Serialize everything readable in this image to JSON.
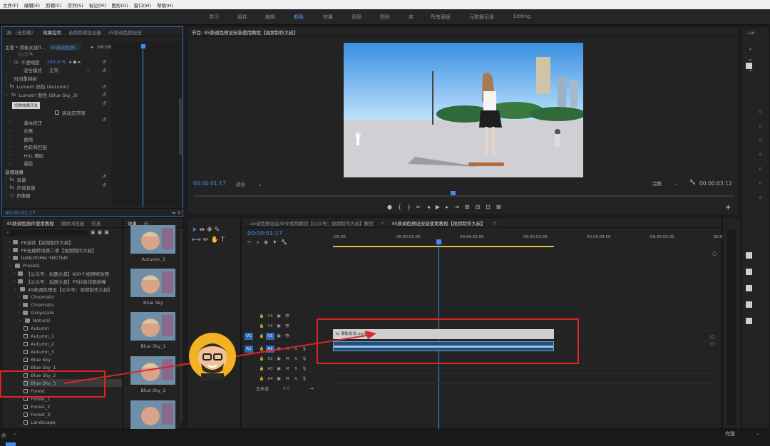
{
  "menu": [
    "文件(F)",
    "编辑(E)",
    "剪辑(C)",
    "序列(S)",
    "标记(M)",
    "图形(G)",
    "窗口(W)",
    "帮助(H)"
  ],
  "workspaces": [
    "学习",
    "组件",
    "编辑",
    "颜色",
    "效果",
    "音频",
    "图形",
    "库",
    "所有面板",
    "元数据记录",
    "Editing"
  ],
  "effect_controls": {
    "tabs": [
      "源:（无剪辑）",
      "效果控件",
      "音频剪辑混合器",
      "45款调色预设安"
    ],
    "clip_select": "主要 * 滑板女孩fl...",
    "sequence_select": "45款调色预...",
    "timecode": ":00:00",
    "opacity_label": "不透明度",
    "opacity_value": "100.0 %",
    "blend_label": "混合模式",
    "blend_value": "正常",
    "time_remap": "时间重映射",
    "lumetri_1": "Lumetri 颜色 (Autumn)",
    "lumetri_2": "Lumetri 颜色 (Blue Sky_3)",
    "tooltip": "切换效果开关",
    "highdyn_label": "高动态范围",
    "sections": [
      "基本校正",
      "创意",
      "曲线",
      "色轮和匹配",
      "HSL 辅助",
      "晕影"
    ],
    "audio_effects": "音频效果",
    "volume": "音量",
    "channel_volume": "声道音量",
    "panner": "声像器",
    "bottom_timecode": "00:00:01:17"
  },
  "program": {
    "title": "节目: 45款调色预设安装使用教程【视频制作大叔】",
    "timecode": "00:00:01:17",
    "fit": "适合",
    "quality": "完整",
    "duration": "00:00:03:12"
  },
  "project": {
    "tabs": [
      "45款调色插件使用教程",
      "媒体浏览器",
      "信息",
      "效果",
      "标"
    ],
    "tree": [
      "PR插件【视频制作大叔】",
      "PR无缝转场第二季【视频制作大叔】",
      "ШАБЛОНЫ ЧИСТЫЕ",
      "Presets",
      "【公众号：后期大叔】600个视频特效预",
      "【公众号：后期大叔】PR抖音炫酷故障",
      "45款调色预设【公众号：视频制作大叔】",
      "Chromatic",
      "Cinematic",
      "Greyscale",
      "Natural",
      "Autumn",
      "Autumn_1",
      "Autumn_2",
      "Autumn_3",
      "Blue Sky",
      "Blue Sky_1",
      "Blue Sky_2",
      "Blue Sky_3",
      "Forest",
      "Forest_1",
      "Forest_2",
      "Forest_3",
      "Landscape"
    ],
    "thumbs": [
      "Autumn_3",
      "Blue Sky",
      "Blue Sky_1",
      "Blue Sky_2"
    ]
  },
  "timeline": {
    "tabs": [
      "ae调色预设在AE中使用教程【公众号：视频制作大叔】教程",
      "45款调色预设安装使用教程【视频制作大叔】"
    ],
    "timecode": "00:00:01:17",
    "ruler": [
      ":00:00",
      "00:00:01:00",
      "00:00:02:00",
      "00:00:03:00",
      "00:00:04:00",
      "00:00:05:00",
      "00:0"
    ],
    "tracks": [
      "V3",
      "V2",
      "V1",
      "A1",
      "A2",
      "A3",
      "A4"
    ],
    "master": "主声道",
    "master_value": "0.0",
    "clip_name": "滑板女孩.mp4[V]"
  },
  "right_panel": {
    "label": "Lui"
  },
  "status": {
    "left": "合",
    "right": "完整"
  },
  "colors": {
    "accent": "#3d8ef0",
    "highlight": "#e02424",
    "playhead": "#3d8ef0"
  }
}
